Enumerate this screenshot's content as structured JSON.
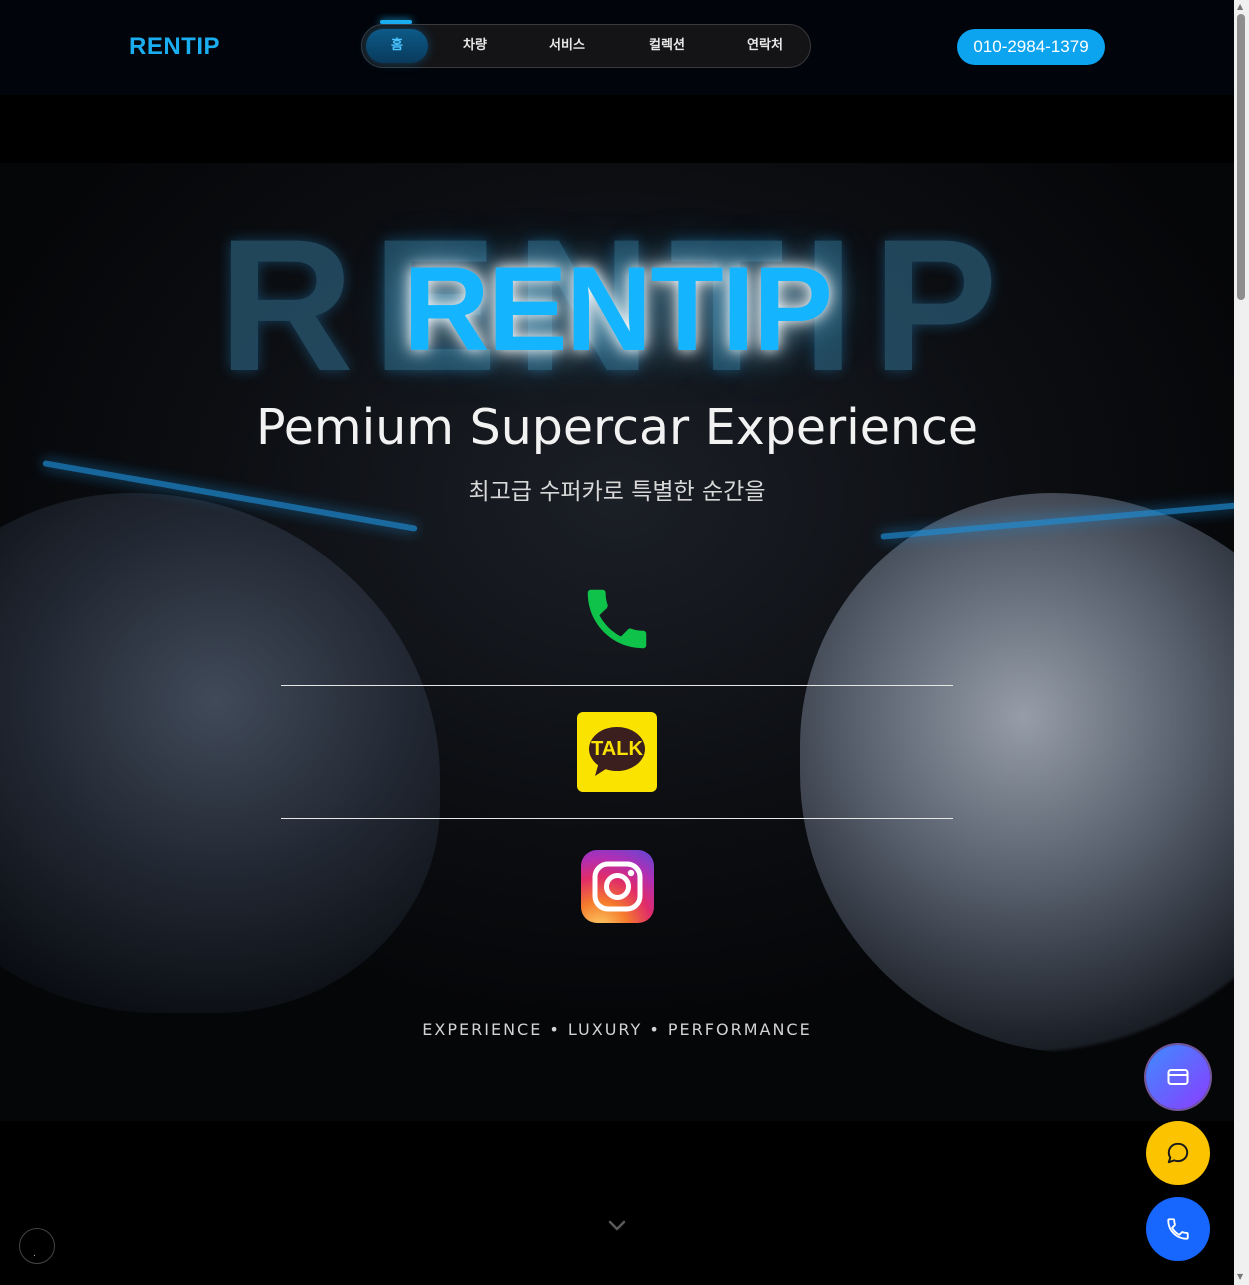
{
  "header": {
    "logo": "RENTIP",
    "nav": [
      {
        "label": "홈",
        "active": true
      },
      {
        "label": "차량",
        "active": false
      },
      {
        "label": "서비스",
        "active": false
      },
      {
        "label": "컬렉션",
        "active": false
      },
      {
        "label": "연락처",
        "active": false
      }
    ],
    "phone": "010-2984-1379"
  },
  "hero": {
    "background_word": "RENTIP",
    "brand": "RENTIP",
    "tagline": "Pemium Supercar Experience",
    "tagline_ko": "최고급 수퍼카로 특별한 순간을",
    "contacts": [
      {
        "icon": "phone-icon"
      },
      {
        "icon": "kakaotalk-icon",
        "text": "TALK"
      },
      {
        "icon": "instagram-icon"
      }
    ],
    "footer": "EXPERIENCE • LUXURY • PERFORMANCE"
  },
  "floating": [
    {
      "icon": "card-icon"
    },
    {
      "icon": "chat-icon"
    },
    {
      "icon": "phone-icon"
    }
  ],
  "mini_button": ".",
  "colors": {
    "accent": "#14b4ff",
    "phone_pill": "#0ca3ef",
    "phone_icon": "#0fc24a",
    "kakao": "#fbe300",
    "chat_fab": "#fbc300",
    "call_fab": "#1767ff"
  }
}
